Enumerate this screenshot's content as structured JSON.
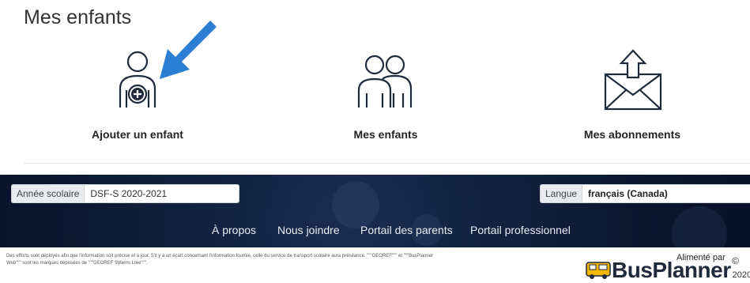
{
  "page": {
    "title": "Mes enfants"
  },
  "tiles": [
    {
      "label": "Ajouter un enfant",
      "icon": "add-child-icon"
    },
    {
      "label": "Mes enfants",
      "icon": "children-icon"
    },
    {
      "label": "Mes abonnements",
      "icon": "envelope-upload-icon"
    }
  ],
  "annotation": {
    "icon": "pointer-arrow-icon",
    "color": "#2a7fd4"
  },
  "footer": {
    "school_year": {
      "label": "Année scolaire",
      "value": "DSF-S 2020-2021"
    },
    "language": {
      "label": "Langue",
      "value": "français (Canada)"
    },
    "nav": [
      "À propos",
      "Nous joindre",
      "Portail des parents",
      "Portail professionnel"
    ],
    "legal_line1": "Des efforts sont déployés afin que l'information soit précise et à jour. S'il y a un écart concernant l'information fournie, celle du service de transport scolaire aura préséance. \"\"\"GEOREF\"\"\" et \"\"\"BusPlanner",
    "legal_line2": "Web\"\"\" sont les marques déposées de \"\"\"GEOREF Sytems Ltée\"\"\"."
  },
  "branding": {
    "powered_by": "Alimenté par",
    "copyright": "©",
    "name": "BusPlanner",
    "year": "2020"
  }
}
